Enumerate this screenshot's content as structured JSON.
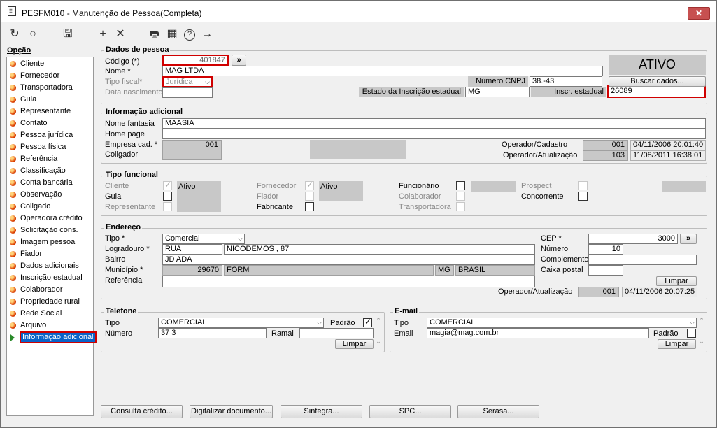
{
  "window": {
    "title": "PESFM010 - Manutenção de Pessoa(Completa)",
    "close": "✕"
  },
  "toolbar": [
    "↻",
    "○",
    "🖫",
    "+",
    "✕",
    "🖶",
    "▦",
    "?",
    "→"
  ],
  "sidebar": {
    "title": "Opção",
    "items": [
      "Cliente",
      "Fornecedor",
      "Transportadora",
      "Guia",
      "Representante",
      "Contato",
      "Pessoa jurídica",
      "Pessoa física",
      "Referência",
      "Classificação",
      "Conta bancária",
      "Observação",
      "Coligado",
      "Operadora crédito",
      "Solicitação cons.",
      "Imagem pessoa",
      "Fiador",
      "Dados adicionais",
      "Inscrição estadual",
      "Colaborador",
      "Propriedade rural",
      "Rede Social",
      "Arquivo",
      "Informação adicional"
    ]
  },
  "dados": {
    "title": "Dados de pessoa",
    "codigo_label": "Código (*)",
    "codigo": "401847",
    "goto": "»",
    "nome_label": "Nome *",
    "nome": "MAG LTDA",
    "tipo_fiscal_label": "Tipo fiscal*",
    "tipo_fiscal": "Jurídica",
    "data_nasc_label": "Data nascimento",
    "cnpj_label": "Número CNPJ",
    "cnpj": "38.-43",
    "estado_label": "Estado da Inscrição estadual",
    "estado": "MG",
    "inscr_label": "Inscr. estadual",
    "inscr": "26089",
    "status": "ATIVO",
    "buscar": "Buscar dados..."
  },
  "info": {
    "title": "Informação adicional",
    "fantasia_label": "Nome fantasia",
    "fantasia": "MAASIA",
    "homepage_label": "Home page",
    "empresa_label": "Empresa cad. *",
    "empresa": "001",
    "coligador_label": "Coligador",
    "op_cad_label": "Operador/Cadastro",
    "op_cad": "001",
    "op_cad_date": "04/11/2006 20:01:40",
    "op_atu_label": "Operador/Atualização",
    "op_atu": "103",
    "op_atu_date": "11/08/2011 16:38:01"
  },
  "funcional": {
    "title": "Tipo funcional",
    "cliente": "Cliente",
    "guia": "Guia",
    "representante": "Representante",
    "ativo1": "Ativo",
    "fornecedor": "Fornecedor",
    "fiador": "Fiador",
    "fabricante": "Fabricante",
    "ativo2": "Ativo",
    "funcionario": "Funcionário",
    "colaborador": "Colaborador",
    "transportadora": "Transportadora",
    "prospect": "Prospect",
    "concorrente": "Concorrente"
  },
  "endereco": {
    "title": "Endereço",
    "tipo_label": "Tipo *",
    "tipo": "Comercial",
    "logradouro_label": "Logradouro *",
    "logradouro_tipo": "RUA",
    "logradouro": "NICODEMOS , 87",
    "bairro_label": "Bairro",
    "bairro": "JD ADA",
    "municipio_label": "Município *",
    "municipio_cod": "29670",
    "municipio": "FORM",
    "uf": "MG",
    "pais": "BRASIL",
    "referencia_label": "Referência",
    "cep_label": "CEP *",
    "cep": "3000",
    "numero_label": "Número",
    "numero": "10",
    "complemento_label": "Complemento",
    "caixa_label": "Caixa postal",
    "limpar": "Limpar",
    "op_atu_label": "Operador/Atualização",
    "op_atu": "001",
    "op_atu_date": "04/11/2006 20:07:25"
  },
  "telefone": {
    "title": "Telefone",
    "tipo_label": "Tipo",
    "tipo": "COMERCIAL",
    "padrao_label": "Padrão",
    "numero_label": "Número",
    "numero": "37 3",
    "ramal_label": "Ramal",
    "limpar": "Limpar"
  },
  "email": {
    "title": "E-mail",
    "tipo_label": "Tipo",
    "tipo": "COMERCIAL",
    "email_label": "Email",
    "email": "magia@mag.com.br",
    "padrao_label": "Padrão",
    "limpar": "Limpar"
  },
  "bottom_buttons": [
    "Consulta crédito...",
    "Digitalizar documento...",
    "Sintegra...",
    "SPC...",
    "Serasa..."
  ]
}
